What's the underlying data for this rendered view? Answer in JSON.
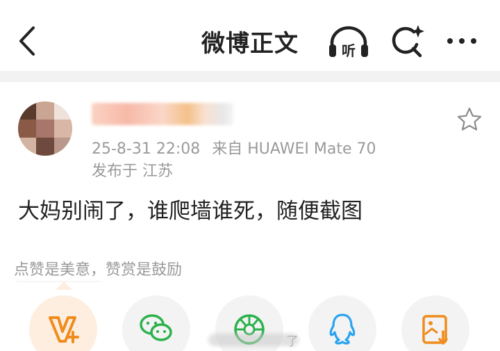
{
  "nav": {
    "title": "微博正文",
    "listen_label": "听",
    "icons": [
      "back-arrow-icon",
      "listen-headphones-icon",
      "ai-search-icon",
      "more-icon"
    ]
  },
  "post": {
    "timestamp": "25-8-31 22:08",
    "source": "来自 HUAWEI Mate 70",
    "location": "发布于 江苏",
    "text": "大妈别闹了，谁爬墙谁死，随便截图"
  },
  "reward_hint": "点赞是美意，赞赏是鼓励",
  "share": {
    "items": [
      {
        "name": "vip-reward",
        "icon": "v-plus-icon"
      },
      {
        "name": "wechat",
        "icon": "wechat-icon"
      },
      {
        "name": "moments",
        "icon": "moments-icon"
      },
      {
        "name": "qq",
        "icon": "qq-icon"
      },
      {
        "name": "save-image",
        "icon": "save-image-icon"
      }
    ],
    "toast_tail": "了"
  },
  "colors": {
    "accent": "#f08c1d",
    "wechat": "#2bb24c",
    "qq": "#29a3ef",
    "moments": "#2bb24c",
    "muted_text": "#9a9a9a"
  }
}
